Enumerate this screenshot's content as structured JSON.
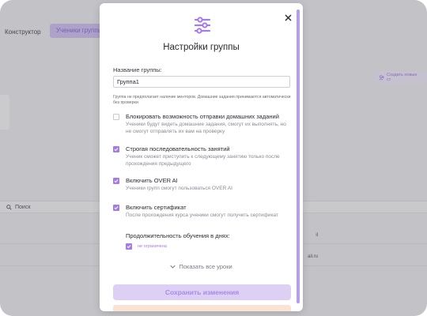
{
  "background": {
    "page_title": "Конструктор",
    "tab_label": "Ученики группы",
    "create_button_label": "Создать новые ст",
    "search_placeholder": "Поиск",
    "rows": [
      {
        "tail": "il"
      },
      {
        "tail": "ail.ru"
      }
    ]
  },
  "modal": {
    "title": "Настройки группы",
    "name_label": "Название группы:",
    "name_value": "Группа1",
    "hint": "Группа не предполагает наличие менторов. Домашние задания принимаются автоматически без проверки",
    "options": [
      {
        "title": "Блокировать возможность отправки домашних заданий",
        "desc": "Ученики будут видеть домашние задания, смогут их выполнять, но не смогут отправлять их вам на проверку",
        "checked": false
      },
      {
        "title": "Строгая последовательность занятий",
        "desc": "Ученик сможет приступить к следующему занятию только после прохождения предыдущего",
        "checked": true
      },
      {
        "title": "Включить OVER AI",
        "desc": "Ученики групп смогут пользоваться OVER AI",
        "checked": true
      },
      {
        "title": "Включить сертификат",
        "desc": "После прохождения курса ученики смогут получить сертификат",
        "checked": true
      }
    ],
    "duration_label": "Продолжительность обучения в днях:",
    "unlimited_label": "не ограничена",
    "unlimited_checked": true,
    "show_all_label": "Показать все уроки",
    "save_label": "Сохранить изменения"
  },
  "colors": {
    "accent": "#a57be9",
    "accent_light": "#ddd0f4",
    "overlay": "#78787d"
  },
  "icons": [
    "sliders-icon",
    "close-icon",
    "chevron-down-icon",
    "search-icon",
    "check-icon",
    "user-add-icon"
  ]
}
